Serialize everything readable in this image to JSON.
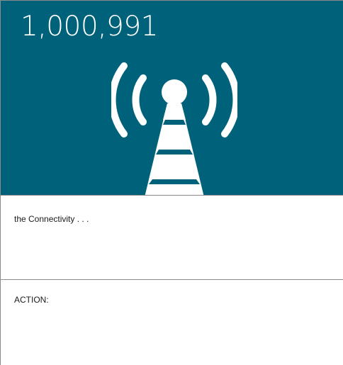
{
  "hero": {
    "count": "1,000,991",
    "icon": "signal-tower-icon",
    "background_color": "#00627a",
    "foreground_color": "#ffffff"
  },
  "sections": {
    "connectivity_text": "the Connectivity . . .",
    "action_label": "ACTION:"
  }
}
